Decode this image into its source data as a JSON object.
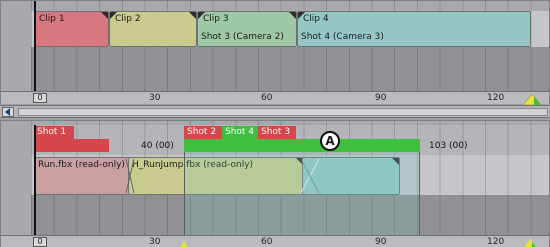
{
  "top": {
    "clips": [
      {
        "label": "Clip 1",
        "color": "#d7777f"
      },
      {
        "label": "Clip 2",
        "color": "#c9cb8e"
      },
      {
        "label": "Clip 3",
        "sub": "Shot 3 (Camera 2)",
        "color": "#9fc9a6"
      },
      {
        "label": "Clip 4",
        "sub": "Shot 4 (Camera 3)",
        "color": "#95c8c5"
      }
    ],
    "ruler": {
      "zero": "0",
      "ticks": [
        "30",
        "60",
        "90",
        "120"
      ]
    }
  },
  "bottom": {
    "shots": [
      {
        "label": "Shot 1",
        "color": "#d8464d"
      },
      {
        "label": "Shot 2",
        "color": "#d8464d"
      },
      {
        "label": "Shot 4",
        "color": "#3fbf3f"
      },
      {
        "label": "Shot 3",
        "color": "#d8464d"
      }
    ],
    "counts": {
      "first": "40 (00)",
      "second": "103 (00)"
    },
    "callout": "A",
    "clips": [
      {
        "label": "Run.fbx (read-only)",
        "color": "#c9a0a2"
      },
      {
        "label": "H_RunJump.fbx (read-only)",
        "color": "#c9cb8e"
      },
      {
        "label": "",
        "color": "#95c8c5"
      }
    ],
    "ruler": {
      "zero": "0",
      "ticks": [
        "30",
        "60",
        "90",
        "120"
      ]
    }
  },
  "colors": {
    "accent_green": "#3fbf3f",
    "marker_yellow": "#e7e33a"
  }
}
